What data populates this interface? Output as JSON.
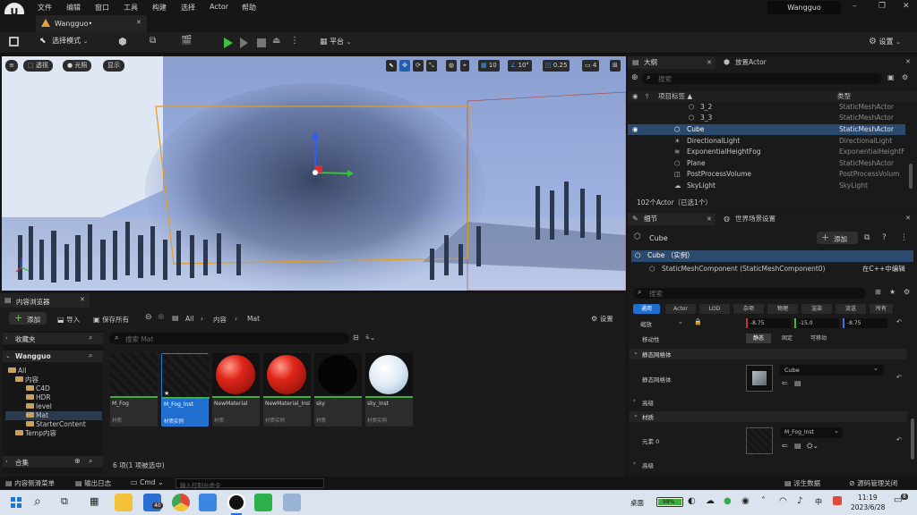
{
  "menu": [
    "文件",
    "编辑",
    "窗口",
    "工具",
    "构建",
    "选择",
    "Actor",
    "帮助"
  ],
  "account": "Wangguo",
  "tab_title": "Wangguo•",
  "toolbar": {
    "mode": "选择模式",
    "platform": "平台",
    "settings": "设置"
  },
  "viewport": {
    "perspective": "透视",
    "lit": "光照",
    "show": "显示",
    "grid": "10",
    "rotation": "10°",
    "scale": "0.25",
    "camera_speed": "4"
  },
  "outliner": {
    "tab": "大纲",
    "tab2": "放置Actor",
    "search_placeholder": "搜索",
    "col_label": "项目标签 ▲",
    "col_type": "类型",
    "rows": [
      {
        "label": "3_2",
        "type": "StaticMeshActor"
      },
      {
        "label": "3_3",
        "type": "StaticMeshActor"
      },
      {
        "label": "Cube",
        "type": "StaticMeshActor"
      },
      {
        "label": "DirectionalLight",
        "type": "DirectionalLight"
      },
      {
        "label": "ExponentialHeightFog",
        "type": "ExponentialHeightF"
      },
      {
        "label": "Plane",
        "type": "StaticMeshActor"
      },
      {
        "label": "PostProcessVolume",
        "type": "PostProcessVolum"
      },
      {
        "label": "SkyLight",
        "type": "SkyLight"
      }
    ],
    "count": "102个Actor（已选1个）"
  },
  "details": {
    "tab": "细节",
    "tab2": "世界场景设置",
    "actor": "Cube",
    "add": "添加",
    "instance": "Cube （实例）",
    "component": "StaticMeshComponent (StaticMeshComponent0)",
    "edit_cpp": "在C++中编辑",
    "search_placeholder": "搜索",
    "filters": [
      "通用",
      "Actor",
      "LOD",
      "杂项",
      "物理",
      "渲染",
      "流送",
      "所有"
    ],
    "scale_label": "缩放",
    "scale_values": [
      "-8.75",
      "-15.0",
      "-8.75"
    ],
    "mobility": "移动性",
    "mobility_opts": [
      "静态",
      "固定",
      "可移动"
    ],
    "sm_section": "静态网格体",
    "sm_label": "静态网格体",
    "sm_value": "Cube",
    "advanced": "高级",
    "mat_section": "材质",
    "element": "元素 0",
    "mat_value": "M_Fog_Inst",
    "advanced2": "高级"
  },
  "content_browser": {
    "tab": "内容浏览器",
    "add": "添加",
    "import": "导入",
    "save_all": "保存所有",
    "path": [
      "All",
      "内容",
      "Mat"
    ],
    "settings": "设置",
    "favorites": "收藏夹",
    "project": "Wangguo",
    "search_placeholder": "搜索 Mat",
    "tree": [
      {
        "label": "All",
        "indent": 0
      },
      {
        "label": "内容",
        "indent": 1
      },
      {
        "label": "C4D",
        "indent": 2
      },
      {
        "label": "HDR",
        "indent": 2
      },
      {
        "label": "level",
        "indent": 2
      },
      {
        "label": "Mat",
        "indent": 2
      },
      {
        "label": "StarterContent",
        "indent": 2
      },
      {
        "label": "Temp内容",
        "indent": 1
      }
    ],
    "collections": "合集",
    "assets": [
      {
        "name": "M_Fog",
        "type": "材质"
      },
      {
        "name": "M_Fog_Inst",
        "type": "材质实例"
      },
      {
        "name": "NewMaterial",
        "type": "材质"
      },
      {
        "name": "NewMaterial_Inst",
        "type": "材质实例"
      },
      {
        "name": "sky",
        "type": "材质"
      },
      {
        "name": "sky_Inst",
        "type": "材质实例"
      }
    ],
    "count": "6 项(1 项被选中)"
  },
  "statusbar": {
    "drawer": "内容侧滑菜单",
    "log": "输出日志",
    "cmd": "Cmd",
    "cmd_placeholder": "输入控制台命令",
    "derived": "派生数据",
    "source": "源码管理关闭"
  },
  "taskbar": {
    "desktop": "桌面",
    "battery": "98%",
    "mail_badge": "40",
    "time": "11:19",
    "date": "2023/6/28",
    "notif": "8",
    "lang": "中"
  }
}
